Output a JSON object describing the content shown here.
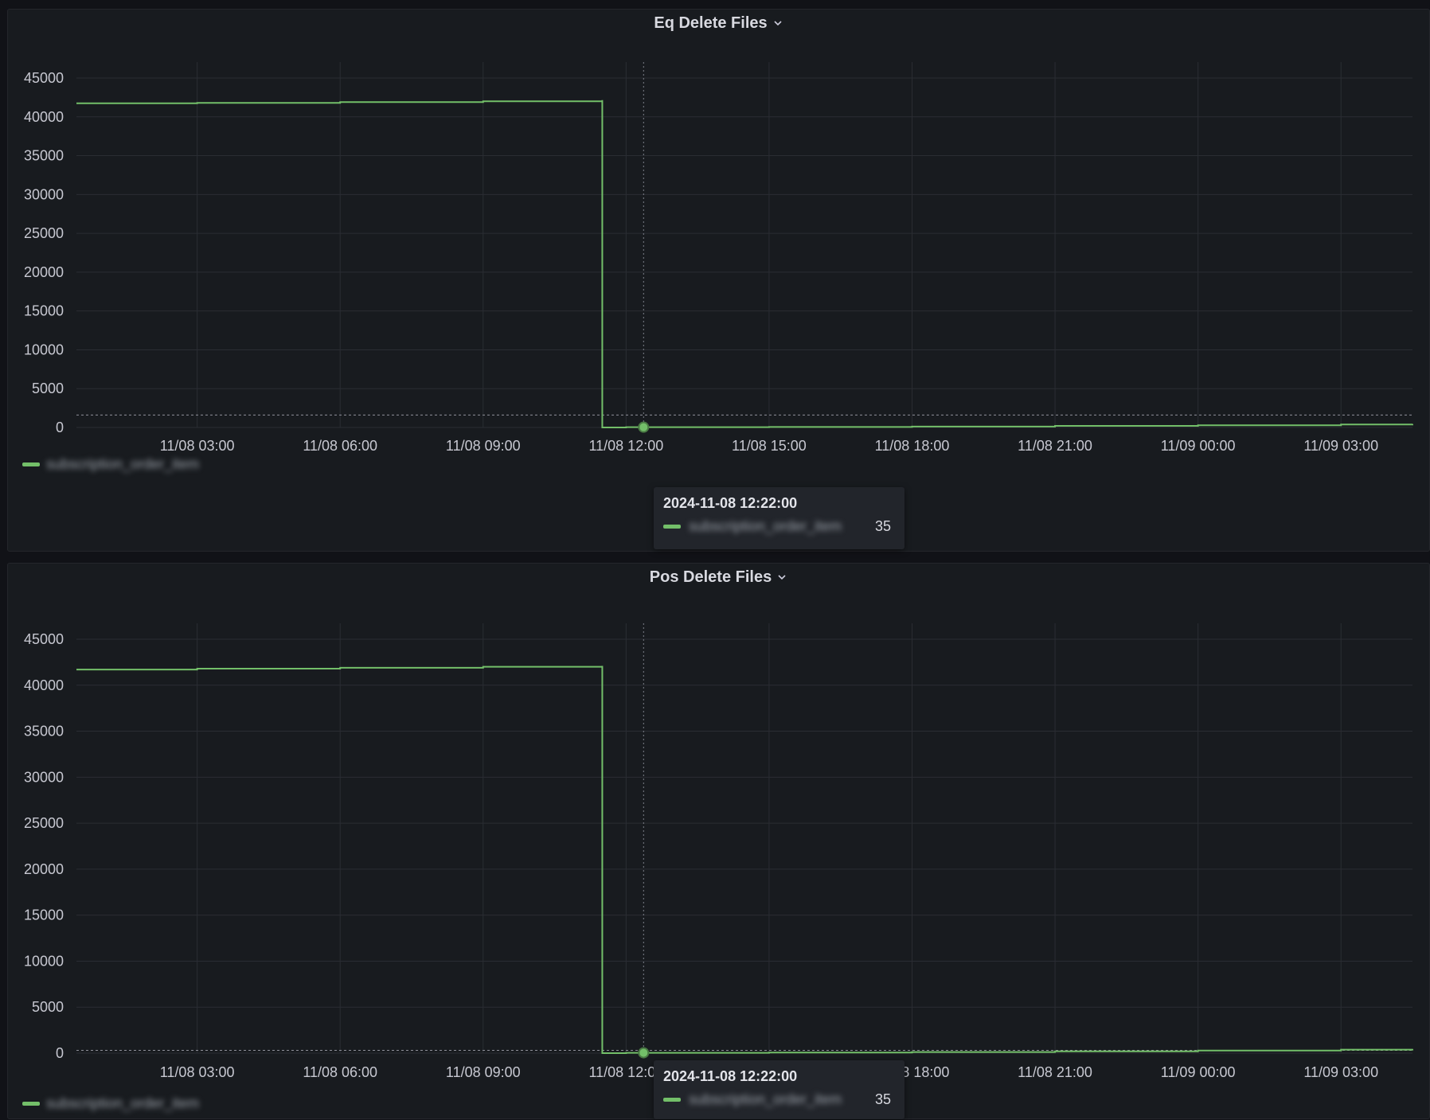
{
  "panels": [
    {
      "title": "Eq Delete Files",
      "legend": "subscription_order_item",
      "tooltip": {
        "time": "2024-11-08 12:22:00",
        "series": "subscription_order_item",
        "value": "35"
      }
    },
    {
      "title": "Pos Delete Files",
      "legend": "subscription_order_item",
      "tooltip": {
        "time": "2024-11-08 12:22:00",
        "series": "subscription_order_item",
        "value": "35"
      }
    }
  ],
  "chart_data": [
    {
      "type": "line",
      "title": "Eq Delete Files",
      "y_ticks": [
        "0",
        "5000",
        "10000",
        "15000",
        "20000",
        "25000",
        "30000",
        "35000",
        "40000",
        "45000"
      ],
      "ylim": [
        0,
        45000
      ],
      "x_ticks": [
        "11/08 03:00",
        "11/08 06:00",
        "11/08 09:00",
        "11/08 12:00",
        "11/08 15:00",
        "11/08 18:00",
        "11/08 21:00",
        "11/09 00:00",
        "11/09 03:00"
      ],
      "xlim": [
        "11/08 00:28",
        "11/09 04:30"
      ],
      "threshold": 1600,
      "crosshair_x": "11/08 12:22",
      "series": [
        {
          "name": "subscription_order_item",
          "color": "#73bf69",
          "x": [
            "11/08 00:28",
            "11/08 03:00",
            "11/08 06:00",
            "11/08 09:00",
            "11/08 11:30",
            "11/08 11:30",
            "11/08 12:00",
            "11/08 15:00",
            "11/08 18:00",
            "11/08 21:00",
            "11/09 00:00",
            "11/09 03:00",
            "11/09 04:30"
          ],
          "y": [
            41750,
            41800,
            41900,
            42000,
            42150,
            0,
            35,
            60,
            120,
            200,
            280,
            380,
            450
          ]
        }
      ]
    },
    {
      "type": "line",
      "title": "Pos Delete Files",
      "y_ticks": [
        "0",
        "5000",
        "10000",
        "15000",
        "20000",
        "25000",
        "30000",
        "35000",
        "40000",
        "45000"
      ],
      "ylim": [
        0,
        45000
      ],
      "x_ticks": [
        "11/08 03:00",
        "11/08 06:00",
        "11/08 09:00",
        "11/08 12:00",
        "11/08 15:00",
        "11/08 18:00",
        "11/08 21:00",
        "11/09 00:00",
        "11/09 03:00"
      ],
      "xlim": [
        "11/08 00:28",
        "11/09 04:30"
      ],
      "threshold": 300,
      "crosshair_x": "11/08 12:22",
      "series": [
        {
          "name": "subscription_order_item",
          "color": "#73bf69",
          "x": [
            "11/08 00:28",
            "11/08 03:00",
            "11/08 06:00",
            "11/08 09:00",
            "11/08 11:30",
            "11/08 11:30",
            "11/08 12:00",
            "11/08 15:00",
            "11/08 18:00",
            "11/08 21:00",
            "11/09 00:00",
            "11/09 03:00",
            "11/09 04:30"
          ],
          "y": [
            41700,
            41800,
            41900,
            42000,
            42100,
            0,
            35,
            60,
            120,
            200,
            280,
            380,
            450
          ]
        }
      ]
    }
  ]
}
